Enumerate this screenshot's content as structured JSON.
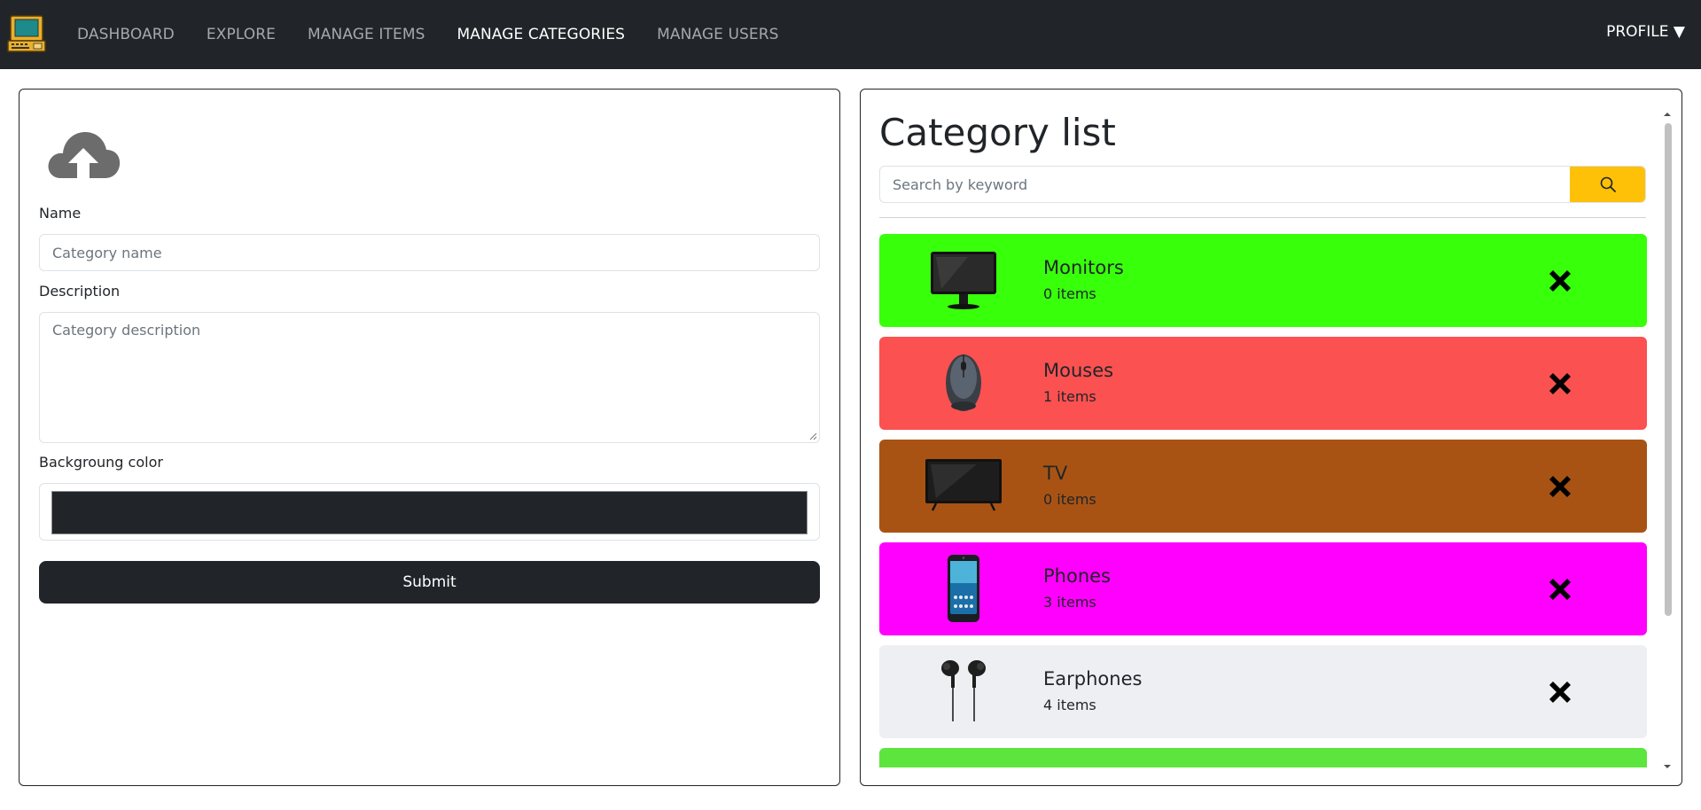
{
  "nav": {
    "items": [
      {
        "label": "DASHBOARD",
        "active": false
      },
      {
        "label": "EXPLORE",
        "active": false
      },
      {
        "label": "MANAGE ITEMS",
        "active": false
      },
      {
        "label": "MANAGE CATEGORIES",
        "active": true
      },
      {
        "label": "MANAGE USERS",
        "active": false
      }
    ],
    "profile_label": "PROFILE ▼"
  },
  "form": {
    "name_label": "Name",
    "name_placeholder": "Category name",
    "description_label": "Description",
    "description_placeholder": "Category description",
    "color_label": "Backgroung color",
    "color_value": "#212529",
    "submit_label": "Submit"
  },
  "category_list": {
    "title": "Category list",
    "search_placeholder": "Search by keyword",
    "categories": [
      {
        "name": "Monitors",
        "count": "0 items",
        "color": "#38ff0a",
        "icon": "monitor-image"
      },
      {
        "name": "Mouses",
        "count": "1 items",
        "color": "#fb5151",
        "icon": "mouse-image"
      },
      {
        "name": "TV",
        "count": "0 items",
        "color": "#a85314",
        "icon": "tv-image"
      },
      {
        "name": "Phones",
        "count": "3 items",
        "color": "#ff00ff",
        "icon": "phone-image"
      },
      {
        "name": "Earphones",
        "count": "4 items",
        "color": "#eeeff3",
        "icon": "earphones-image"
      },
      {
        "name": "",
        "count": "",
        "color": "#5ce53d",
        "icon": "category-image"
      }
    ]
  },
  "colors": {
    "navbar": "#212529",
    "accent": "#ffc107"
  }
}
